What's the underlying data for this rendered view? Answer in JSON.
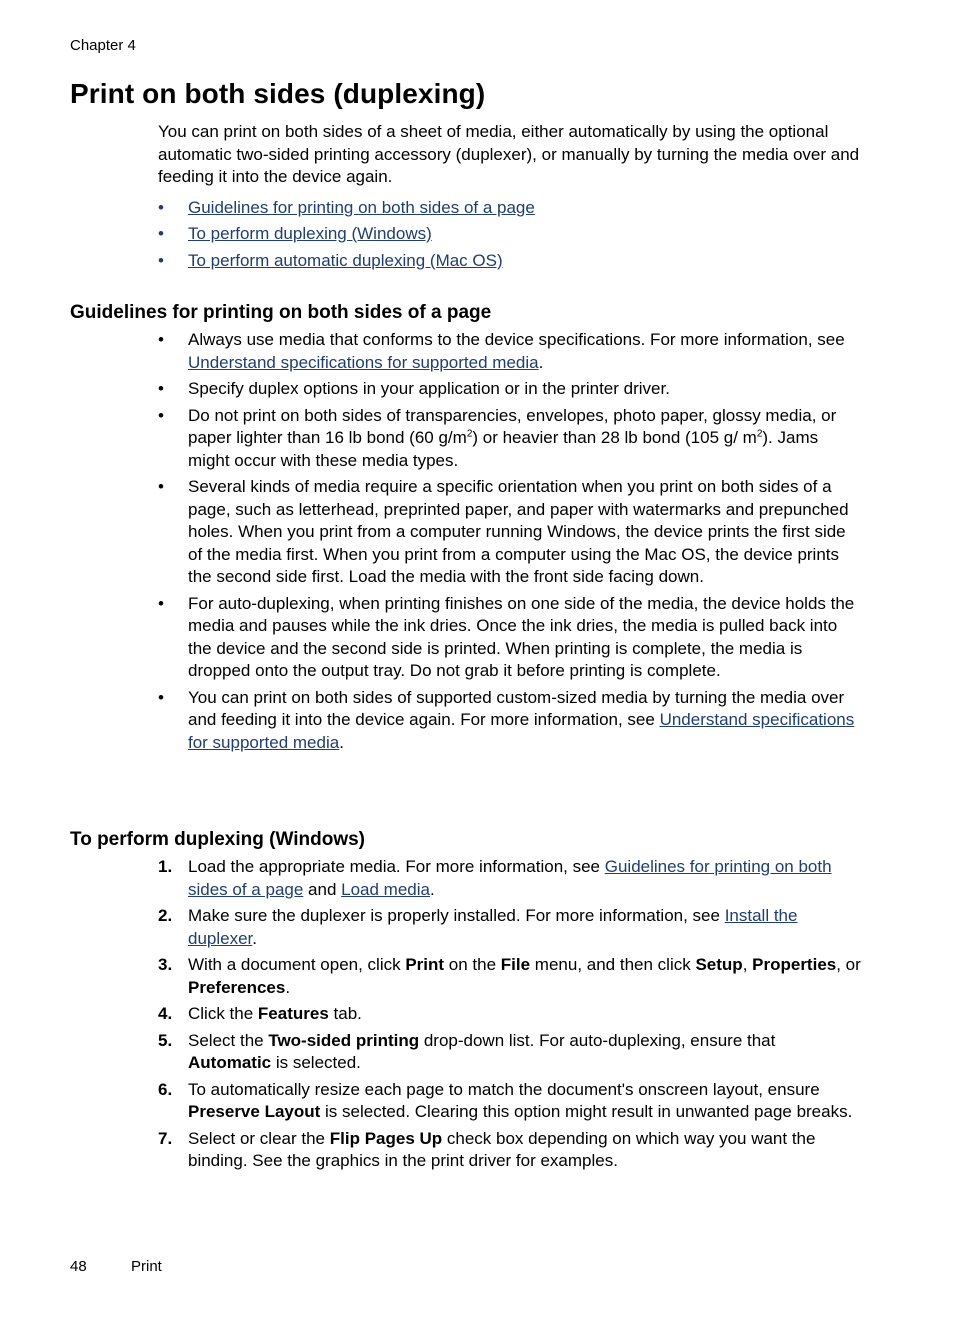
{
  "header": {
    "chapter": "Chapter 4"
  },
  "title": "Print on both sides (duplexing)",
  "intro": {
    "text": "You can print on both sides of a sheet of media, either automatically by using the optional automatic two-sided printing accessory (duplexer), or manually by turning the media over and feeding it into the device again.",
    "links": [
      "Guidelines for printing on both sides of a page",
      "To perform duplexing (Windows)",
      "To perform automatic duplexing (Mac OS)"
    ]
  },
  "guidelines": {
    "heading": "Guidelines for printing on both sides of a page",
    "b1_text": "Always use media that conforms to the device specifications. For more information, see ",
    "b1_link": "Understand specifications for supported media",
    "b1_end": ".",
    "b2_text": "Specify duplex options in your application or in the printer driver.",
    "b3_a": "Do not print on both sides of transparencies, envelopes, photo paper, glossy media, or paper lighter than 16 lb bond (60 g/m",
    "b3_sup1": "2",
    "b3_b": ") or heavier than 28 lb bond (105 g/ m",
    "b3_sup2": "2",
    "b3_c": "). Jams might occur with these media types.",
    "b4_text": "Several kinds of media require a specific orientation when you print on both sides of a page, such as letterhead, preprinted paper, and paper with watermarks and prepunched holes. When you print from a computer running Windows, the device prints the first side of the media first. When you print from a computer using the Mac OS, the device prints the second side first. Load the media with the front side facing down.",
    "b5_text": "For auto-duplexing, when printing finishes on one side of the media, the device holds the media and pauses while the ink dries. Once the ink dries, the media is pulled back into the device and the second side is printed. When printing is complete, the media is dropped onto the output tray. Do not grab it before printing is complete.",
    "b6_text": "You can print on both sides of supported custom-sized media by turning the media over and feeding it into the device again. For more information, see ",
    "b6_link": "Understand specifications for supported media",
    "b6_end": "."
  },
  "windows": {
    "heading": "To perform duplexing (Windows)",
    "s1": {
      "num": "1.",
      "a": "Load the appropriate media. For more information, see ",
      "link1": "Guidelines for printing on both sides of a page",
      "b": " and ",
      "link2": "Load media",
      "c": "."
    },
    "s2": {
      "num": "2.",
      "a": "Make sure the duplexer is properly installed. For more information, see ",
      "link": "Install the duplexer",
      "b": "."
    },
    "s3": {
      "num": "3.",
      "a": "With a document open, click ",
      "b1": "Print",
      "a2": " on the ",
      "b2": "File",
      "a3": " menu, and then click ",
      "b3": "Setup",
      "a4": ", ",
      "b4": "Properties",
      "a5": ", or ",
      "b5": "Preferences",
      "a6": "."
    },
    "s4": {
      "num": "4.",
      "a": "Click the ",
      "b1": "Features",
      "a2": " tab."
    },
    "s5": {
      "num": "5.",
      "a": "Select the ",
      "b1": "Two-sided printing",
      "a2": " drop-down list. For auto-duplexing, ensure that ",
      "b2": "Automatic",
      "a3": " is selected."
    },
    "s6": {
      "num": "6.",
      "a": "To automatically resize each page to match the document's onscreen layout, ensure ",
      "b1": "Preserve Layout",
      "a2": " is selected. Clearing this option might result in unwanted page breaks."
    },
    "s7": {
      "num": "7.",
      "a": "Select or clear the ",
      "b1": "Flip Pages Up",
      "a2": " check box depending on which way you want the binding. See the graphics in the print driver for examples."
    }
  },
  "footer": {
    "page_number": "48",
    "section": "Print"
  },
  "bullet_char": "•"
}
